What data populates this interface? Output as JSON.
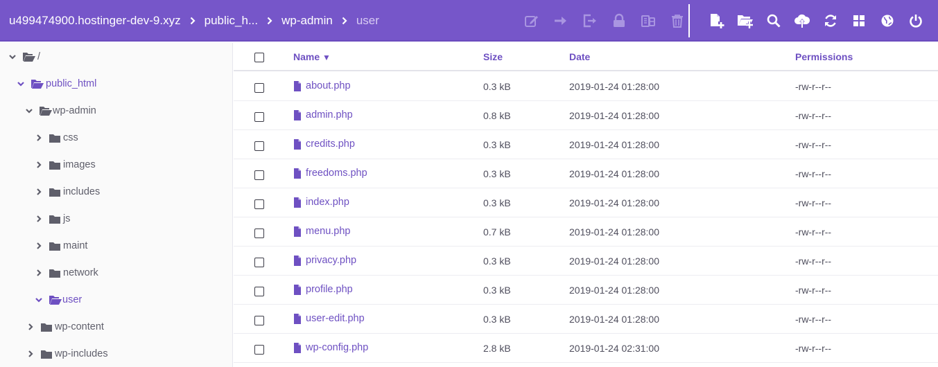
{
  "breadcrumb": {
    "items": [
      "u499474900.hostinger-dev-9.xyz",
      "public_h...",
      "wp-admin",
      "user"
    ]
  },
  "toolbar": {
    "selection_actions": [
      "edit-icon",
      "move-icon",
      "rename-icon",
      "lock-icon",
      "archive-icon",
      "trash-icon"
    ],
    "global_actions": [
      "new-file-icon",
      "new-folder-icon",
      "search-icon",
      "upload-icon",
      "refresh-icon",
      "grid-view-icon",
      "globe-icon",
      "power-icon"
    ]
  },
  "tree": {
    "root": "/",
    "nodes": [
      "public_html",
      "wp-admin",
      "css",
      "images",
      "includes",
      "js",
      "maint",
      "network",
      "user",
      "wp-content",
      "wp-includes"
    ]
  },
  "table": {
    "headers": {
      "name": "Name",
      "sort_indicator": "▼",
      "size": "Size",
      "date": "Date",
      "permissions": "Permissions"
    },
    "rows": [
      {
        "name": "about.php",
        "size": "0.3 kB",
        "date": "2019-01-24 01:28:00",
        "perm": "-rw-r--r--"
      },
      {
        "name": "admin.php",
        "size": "0.8 kB",
        "date": "2019-01-24 01:28:00",
        "perm": "-rw-r--r--"
      },
      {
        "name": "credits.php",
        "size": "0.3 kB",
        "date": "2019-01-24 01:28:00",
        "perm": "-rw-r--r--"
      },
      {
        "name": "freedoms.php",
        "size": "0.3 kB",
        "date": "2019-01-24 01:28:00",
        "perm": "-rw-r--r--"
      },
      {
        "name": "index.php",
        "size": "0.3 kB",
        "date": "2019-01-24 01:28:00",
        "perm": "-rw-r--r--"
      },
      {
        "name": "menu.php",
        "size": "0.7 kB",
        "date": "2019-01-24 01:28:00",
        "perm": "-rw-r--r--"
      },
      {
        "name": "privacy.php",
        "size": "0.3 kB",
        "date": "2019-01-24 01:28:00",
        "perm": "-rw-r--r--"
      },
      {
        "name": "profile.php",
        "size": "0.3 kB",
        "date": "2019-01-24 01:28:00",
        "perm": "-rw-r--r--"
      },
      {
        "name": "user-edit.php",
        "size": "0.3 kB",
        "date": "2019-01-24 01:28:00",
        "perm": "-rw-r--r--"
      },
      {
        "name": "wp-config.php",
        "size": "2.8 kB",
        "date": "2019-01-24 02:31:00",
        "perm": "-rw-r--r--"
      }
    ]
  },
  "colors": {
    "brand": "#7656c9",
    "accent": "#6e50c2",
    "muted_icon": "#a995e1"
  }
}
